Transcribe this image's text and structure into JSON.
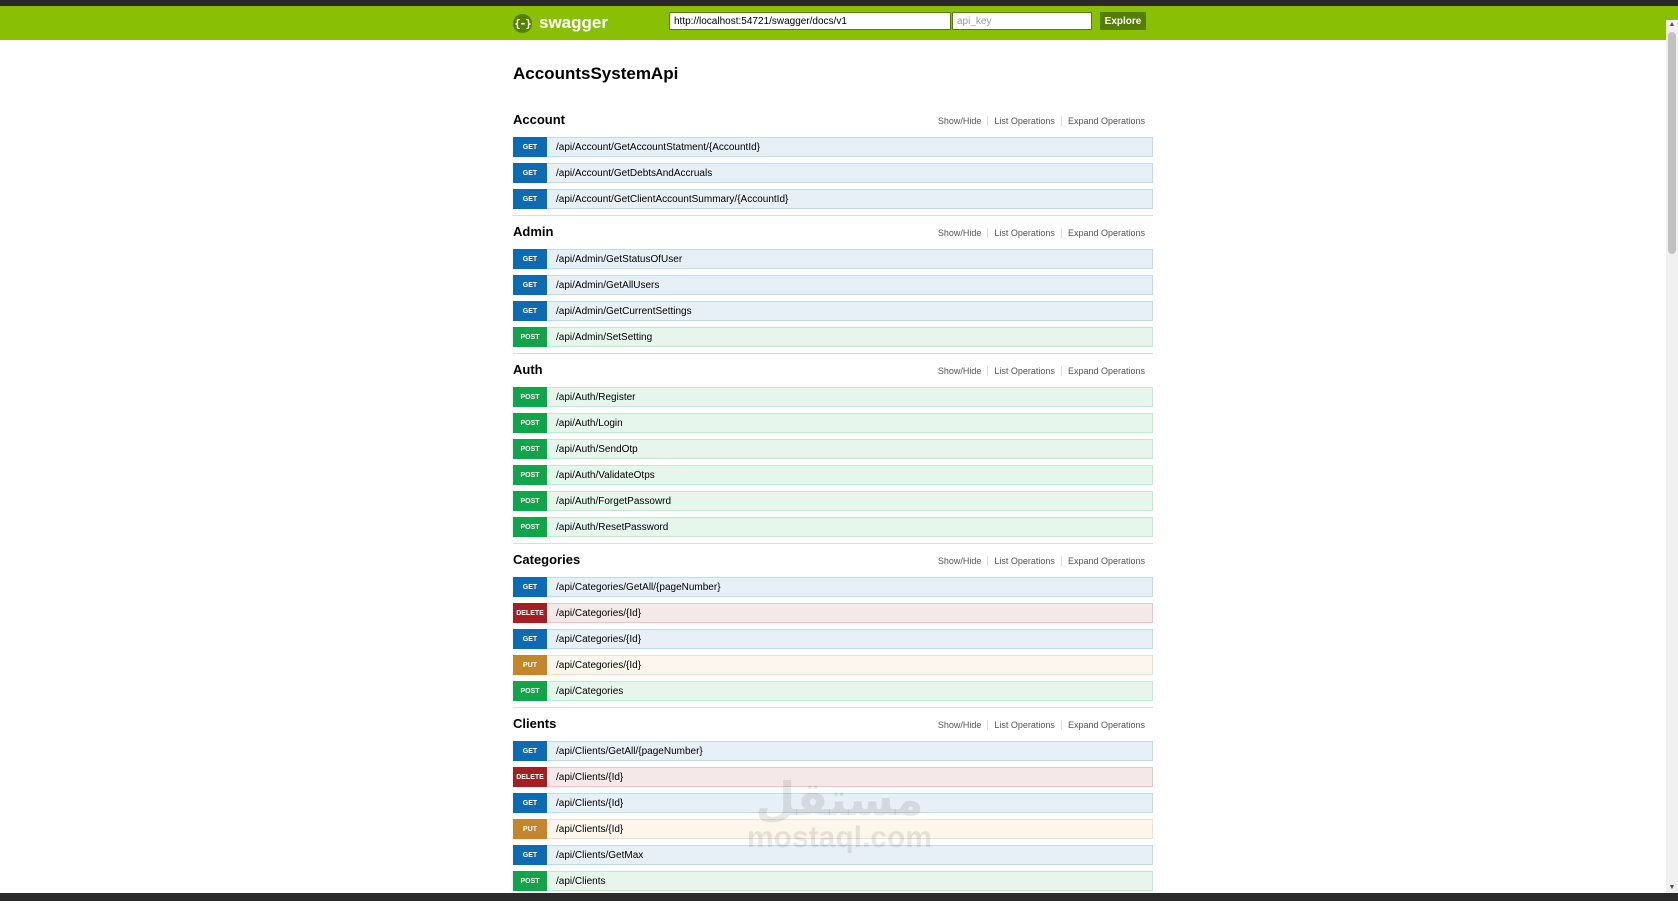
{
  "header": {
    "logo_text": "swagger",
    "logo_icon": "swagger-braces-icon",
    "url_value": "http://localhost:54721/swagger/docs/v1",
    "api_key_placeholder": "api_key",
    "explore_label": "Explore",
    "bar_color": "#89bf04"
  },
  "title": "AccountsSystemApi",
  "resource_links": [
    "Show/Hide",
    "List Operations",
    "Expand Operations"
  ],
  "method_colors": {
    "GET": "#0f6ab4",
    "POST": "#10a54a",
    "DELETE": "#a41e22",
    "PUT": "#c5862b"
  },
  "resources": [
    {
      "name": "Account",
      "operations": [
        {
          "method": "GET",
          "path": "/api/Account/GetAccountStatment/{AccountId}"
        },
        {
          "method": "GET",
          "path": "/api/Account/GetDebtsAndAccruals"
        },
        {
          "method": "GET",
          "path": "/api/Account/GetClientAccountSummary/{AccountId}"
        }
      ]
    },
    {
      "name": "Admin",
      "operations": [
        {
          "method": "GET",
          "path": "/api/Admin/GetStatusOfUser"
        },
        {
          "method": "GET",
          "path": "/api/Admin/GetAllUsers"
        },
        {
          "method": "GET",
          "path": "/api/Admin/GetCurrentSettings"
        },
        {
          "method": "POST",
          "path": "/api/Admin/SetSetting"
        }
      ]
    },
    {
      "name": "Auth",
      "operations": [
        {
          "method": "POST",
          "path": "/api/Auth/Register"
        },
        {
          "method": "POST",
          "path": "/api/Auth/Login"
        },
        {
          "method": "POST",
          "path": "/api/Auth/SendOtp"
        },
        {
          "method": "POST",
          "path": "/api/Auth/ValidateOtps"
        },
        {
          "method": "POST",
          "path": "/api/Auth/ForgetPassowrd"
        },
        {
          "method": "POST",
          "path": "/api/Auth/ResetPassword"
        }
      ]
    },
    {
      "name": "Categories",
      "operations": [
        {
          "method": "GET",
          "path": "/api/Categories/GetAll/{pageNumber}"
        },
        {
          "method": "DELETE",
          "path": "/api/Categories/{Id}"
        },
        {
          "method": "GET",
          "path": "/api/Categories/{Id}"
        },
        {
          "method": "PUT",
          "path": "/api/Categories/{Id}"
        },
        {
          "method": "POST",
          "path": "/api/Categories"
        }
      ]
    },
    {
      "name": "Clients",
      "operations": [
        {
          "method": "GET",
          "path": "/api/Clients/GetAll/{pageNumber}"
        },
        {
          "method": "DELETE",
          "path": "/api/Clients/{Id}"
        },
        {
          "method": "GET",
          "path": "/api/Clients/{Id}"
        },
        {
          "method": "PUT",
          "path": "/api/Clients/{Id}"
        },
        {
          "method": "GET",
          "path": "/api/Clients/GetMax"
        },
        {
          "method": "POST",
          "path": "/api/Clients"
        }
      ]
    }
  ],
  "watermark": {
    "arabic": "مستقل",
    "latin": "mostaql.com"
  }
}
